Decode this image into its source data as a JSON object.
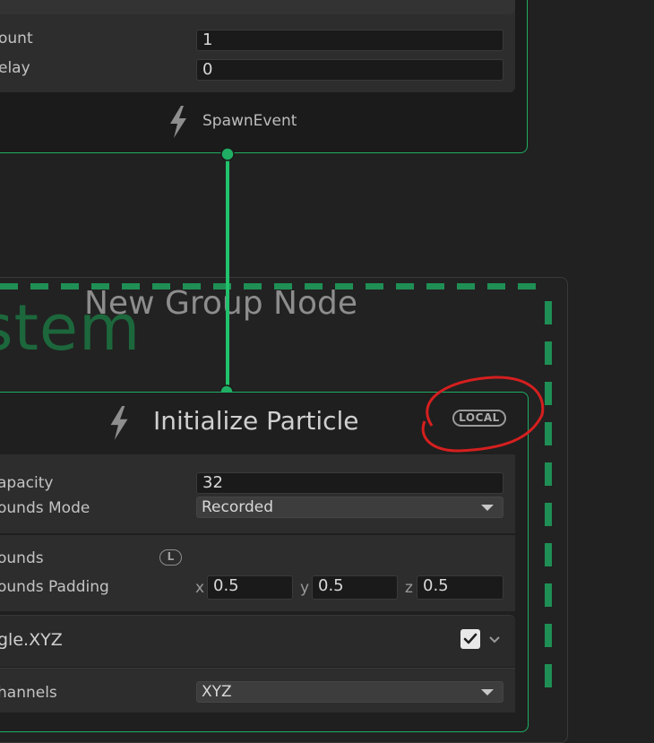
{
  "spawn_node": {
    "count_label": "ount",
    "count_value": "1",
    "delay_label": "elay",
    "delay_value": "0",
    "output_label": "SpawnEvent"
  },
  "group": {
    "title": "New Group Node",
    "system_watermark": "stem"
  },
  "initialize": {
    "title": "Initialize Particle",
    "space_badge": "LOCAL",
    "capacity_label": "apacity",
    "capacity_value": "32",
    "bounds_mode_label": "ounds Mode",
    "bounds_mode_value": "Recorded",
    "bounds_label": "ounds",
    "bounds_space_badge": "L",
    "bounds_padding_label": "ounds Padding",
    "padding": {
      "x_label": "x",
      "x_value": "0.5",
      "y_label": "y",
      "y_value": "0.5",
      "z_label": "z",
      "z_value": "0.5"
    }
  },
  "block": {
    "title": "gle.XYZ",
    "channels_label": "hannels",
    "channels_value": "XYZ"
  },
  "colors": {
    "accent_green": "#1fae63",
    "annotation_red": "#d51f1f",
    "background": "#212121"
  }
}
